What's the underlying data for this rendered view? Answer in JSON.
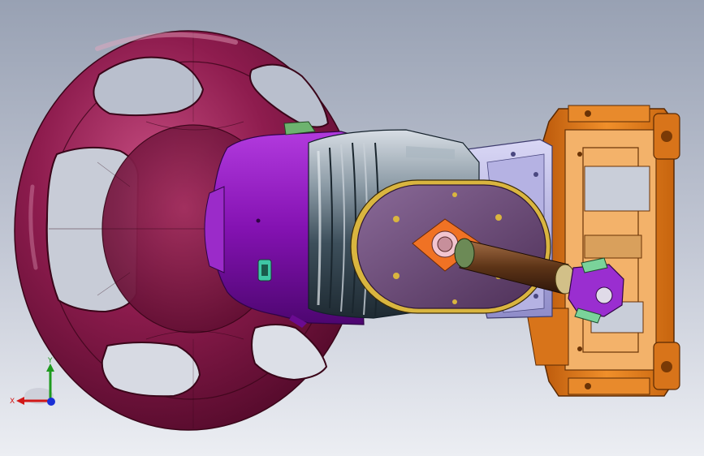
{
  "viewport": {
    "background_top": "#9aa3b5",
    "background_bottom": "#ecedf3"
  },
  "model": {
    "steering_wheel_color": "#7a1040",
    "column_housing_color": "#8a13b5",
    "shaft_color": "#6b4226",
    "bracket_color": "#e07b16",
    "mount_plate_color": "#6c4a7c"
  },
  "triad": {
    "x_label": "X",
    "y_label": "Y",
    "x_color": "#d21818",
    "y_color": "#1e9a1e",
    "z_color": "#1a2fd6"
  }
}
